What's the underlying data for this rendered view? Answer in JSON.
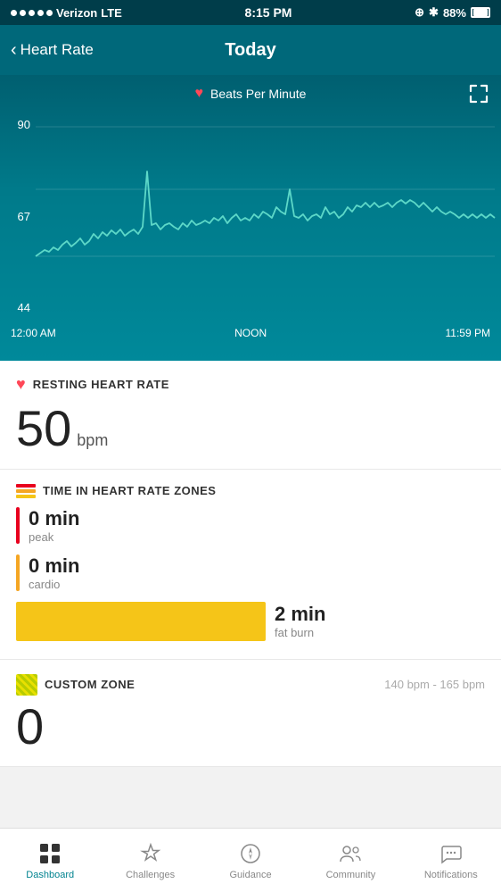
{
  "statusBar": {
    "carrier": "Verizon",
    "network": "LTE",
    "time": "8:15 PM",
    "battery": "88%"
  },
  "navHeader": {
    "backLabel": "Heart Rate",
    "title": "Today"
  },
  "chart": {
    "legend": "Beats Per Minute",
    "yLabels": [
      "90",
      "67",
      "44"
    ],
    "xLabels": [
      "12:00 AM",
      "NOON",
      "11:59 PM"
    ]
  },
  "sections": {
    "restingHeartRate": {
      "title": "RESTING HEART RATE",
      "value": "50",
      "unit": "bpm"
    },
    "timeInZones": {
      "title": "TIME IN HEART RATE ZONES",
      "zones": [
        {
          "value": "0 min",
          "label": "peak",
          "color": "#e8001e"
        },
        {
          "value": "0 min",
          "label": "cardio",
          "color": "#f5a623"
        },
        {
          "value": "2 min",
          "label": "fat burn",
          "color": "#f5c518",
          "barWidth": 280
        }
      ]
    },
    "customZone": {
      "title": "CUSTOM ZONE",
      "range": "140 bpm - 165 bpm",
      "value": "0"
    }
  },
  "bottomNav": {
    "items": [
      {
        "label": "Dashboard",
        "icon": "grid-icon",
        "active": true
      },
      {
        "label": "Challenges",
        "icon": "star-icon",
        "active": false
      },
      {
        "label": "Guidance",
        "icon": "compass-icon",
        "active": false
      },
      {
        "label": "Community",
        "icon": "people-icon",
        "active": false
      },
      {
        "label": "Notifications",
        "icon": "chat-icon",
        "active": false
      }
    ]
  }
}
